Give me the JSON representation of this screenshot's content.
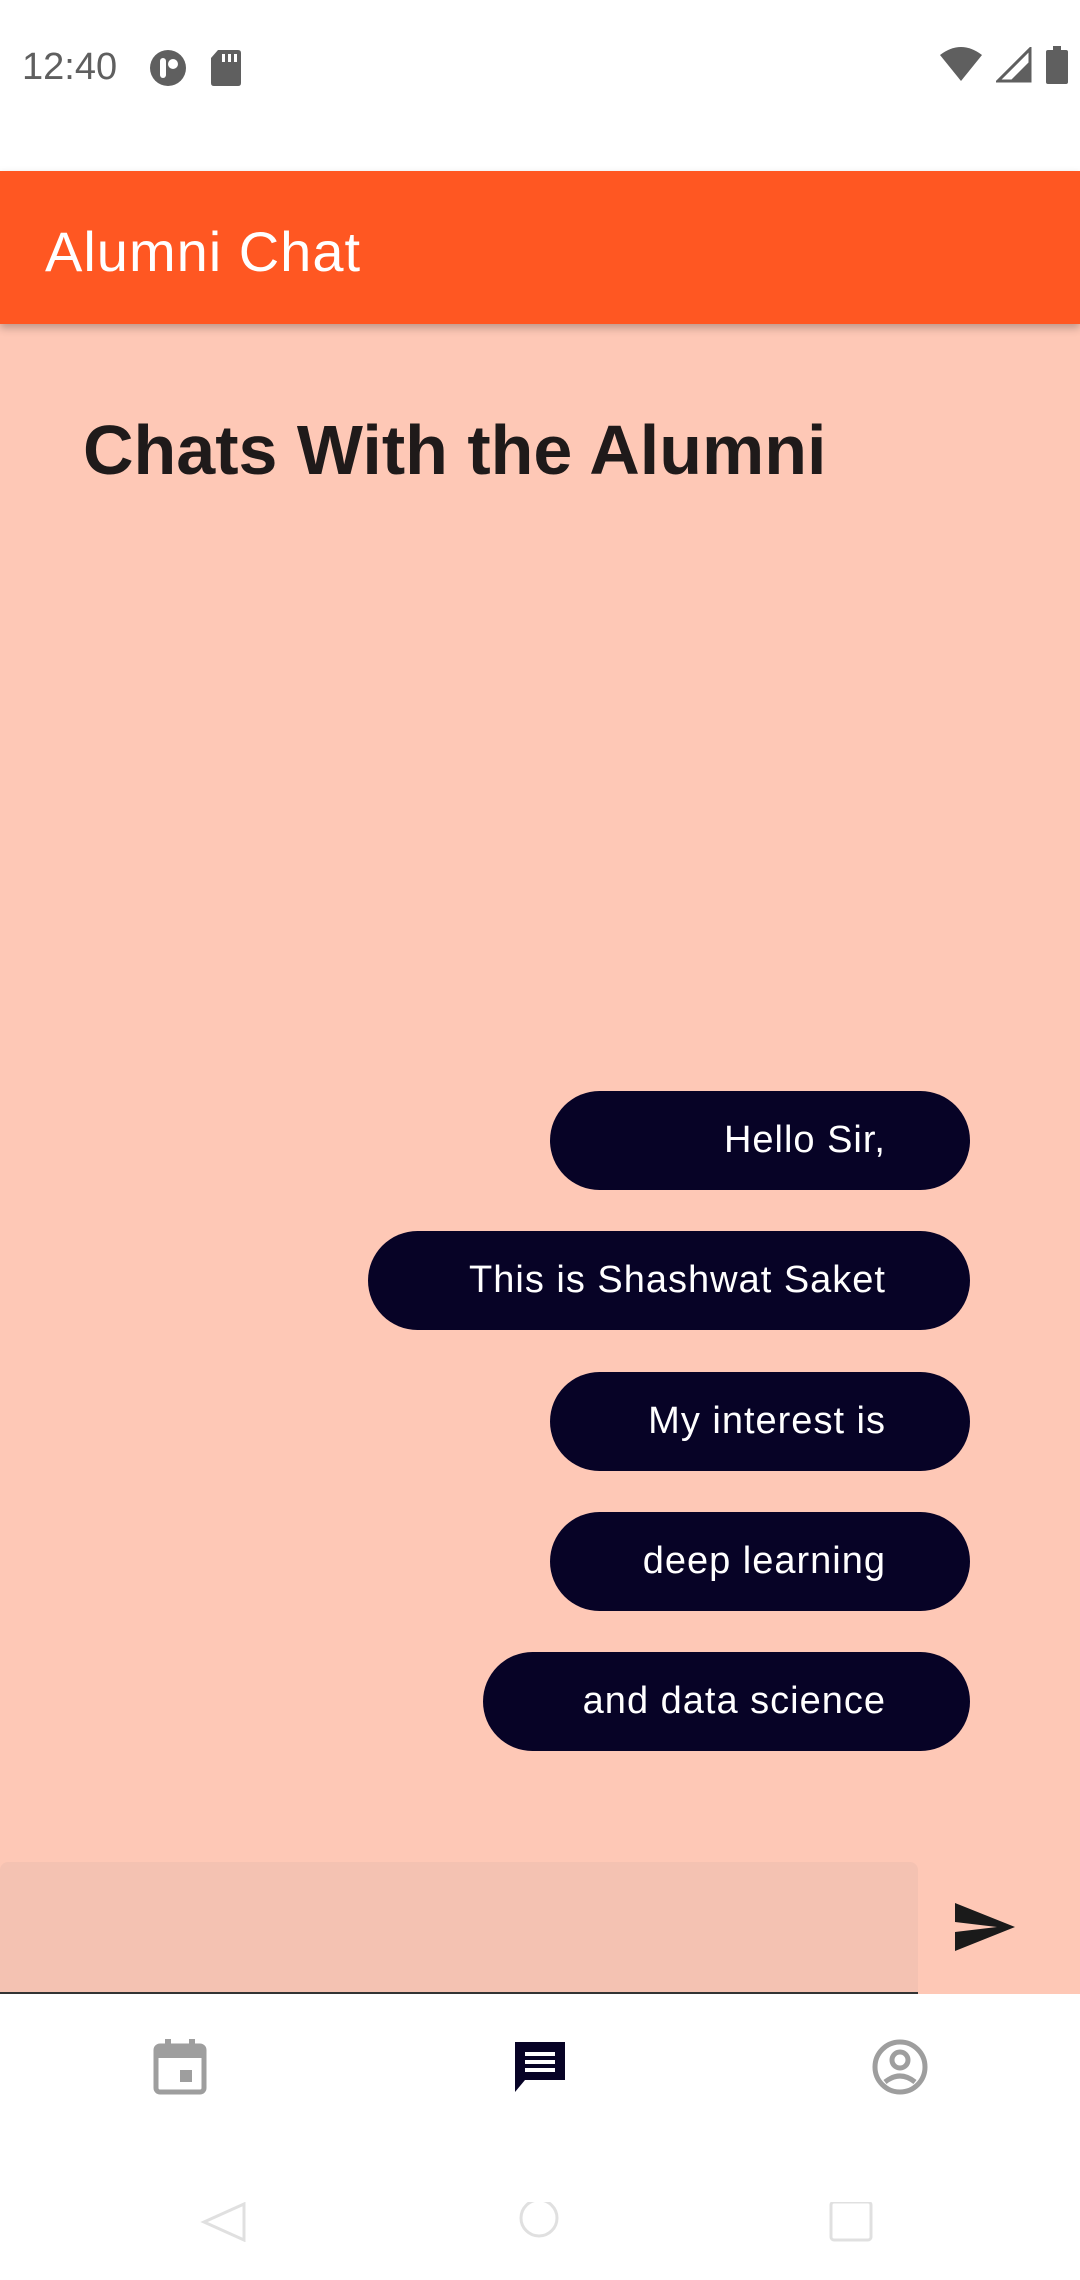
{
  "status_bar": {
    "time": "12:40",
    "left_icons": [
      "notification-app-icon",
      "sd-card-icon"
    ],
    "right_icons": [
      "wifi-icon",
      "cell-signal-icon",
      "battery-icon"
    ]
  },
  "app_bar": {
    "title": "Alumni Chat",
    "color": "#ff5722"
  },
  "main": {
    "heading": "Chats With the Alumni",
    "background": "#fec8b6",
    "messages": [
      {
        "text": "Hello Sir,"
      },
      {
        "text": "This is Shashwat Saket"
      },
      {
        "text": "My interest is"
      },
      {
        "text": "deep learning"
      },
      {
        "text": "and data science"
      }
    ],
    "bubble_color": "#070326"
  },
  "composer": {
    "value": "",
    "placeholder": "",
    "send_icon": "send-icon"
  },
  "bottom_nav": {
    "items": [
      {
        "icon": "calendar-icon",
        "active": false
      },
      {
        "icon": "chat-icon",
        "active": true
      },
      {
        "icon": "account-circle-icon",
        "active": false
      }
    ]
  },
  "system_nav": {
    "buttons": [
      "back-icon",
      "home-icon",
      "recents-icon"
    ]
  }
}
